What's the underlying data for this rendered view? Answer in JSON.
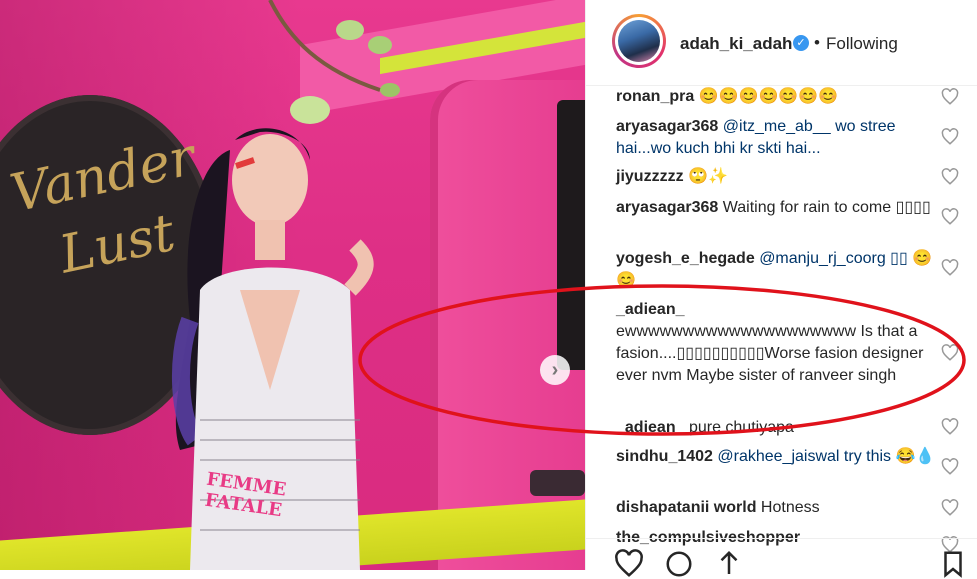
{
  "post": {
    "author": "adah_ki_adah",
    "follow_status": "Following",
    "dot": "•"
  },
  "photo": {
    "sign_text": "Vander Lust",
    "belt_text": "FEMME FATALE",
    "next_arrow": "›"
  },
  "comments": [
    {
      "user": "ronan_pra",
      "text": "😊😊😊😊😊😊😊"
    },
    {
      "user": "aryasagar368",
      "text": "@itz_me_ab__ wo stree hai...wo kuch bhi kr skti hai..."
    },
    {
      "user": "jiyuzzzzz",
      "text": "🙄✨"
    },
    {
      "user": "aryasagar368",
      "text": "Waiting for rain to come ▯▯▯▯"
    },
    {
      "user": "yogesh_e_hegade",
      "text": "@manju_rj_coorg ▯▯ 😊 😊"
    },
    {
      "user": "_adiean_",
      "text": "ewwwwwwwwwwwwwwwwwwww Is that a fasion....▯▯▯▯▯▯▯▯▯▯Worse fasion designer ever nvm Maybe sister of ranveer singh"
    },
    {
      "user": "_adiean_",
      "text": "pure chutiyapa"
    },
    {
      "user": "sindhu_1402",
      "text": "@rakhee_jaiswal try this 😂💧"
    },
    {
      "user": "dishapatanii world",
      "text": "Hotness"
    },
    {
      "user": "the_compulsiveshopper",
      "text": ""
    }
  ],
  "icons": {
    "verified": "verified-badge-icon",
    "heart": "heart-icon",
    "like": "heart-outline-icon",
    "comment": "comment-icon",
    "share": "share-icon",
    "save": "bookmark-icon"
  },
  "colors": {
    "annotation": "#e0121b",
    "verified": "#3897f0",
    "photo_pink": "#e8398f",
    "stripe_yellow": "#d4e43a"
  }
}
